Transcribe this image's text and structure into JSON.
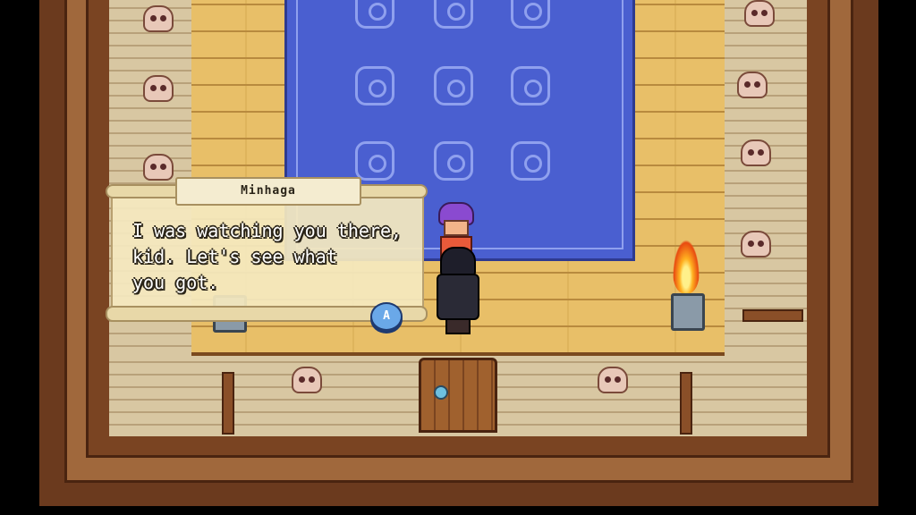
{
  "dialog": {
    "speaker": "Minhaga",
    "text": "I was watching you there,\nkid. Let's see what\nyou got.",
    "advance_button": "A"
  },
  "colors": {
    "rug": "#4a5fd0",
    "floor": "#e8bf68",
    "frame": "#6b3a1e",
    "dialog_bg": "#f4e8be",
    "button": "#6aa8e8"
  },
  "icons": {
    "advance": "a-button-icon",
    "decor": "skull-icon",
    "flame": "torch-icon"
  }
}
